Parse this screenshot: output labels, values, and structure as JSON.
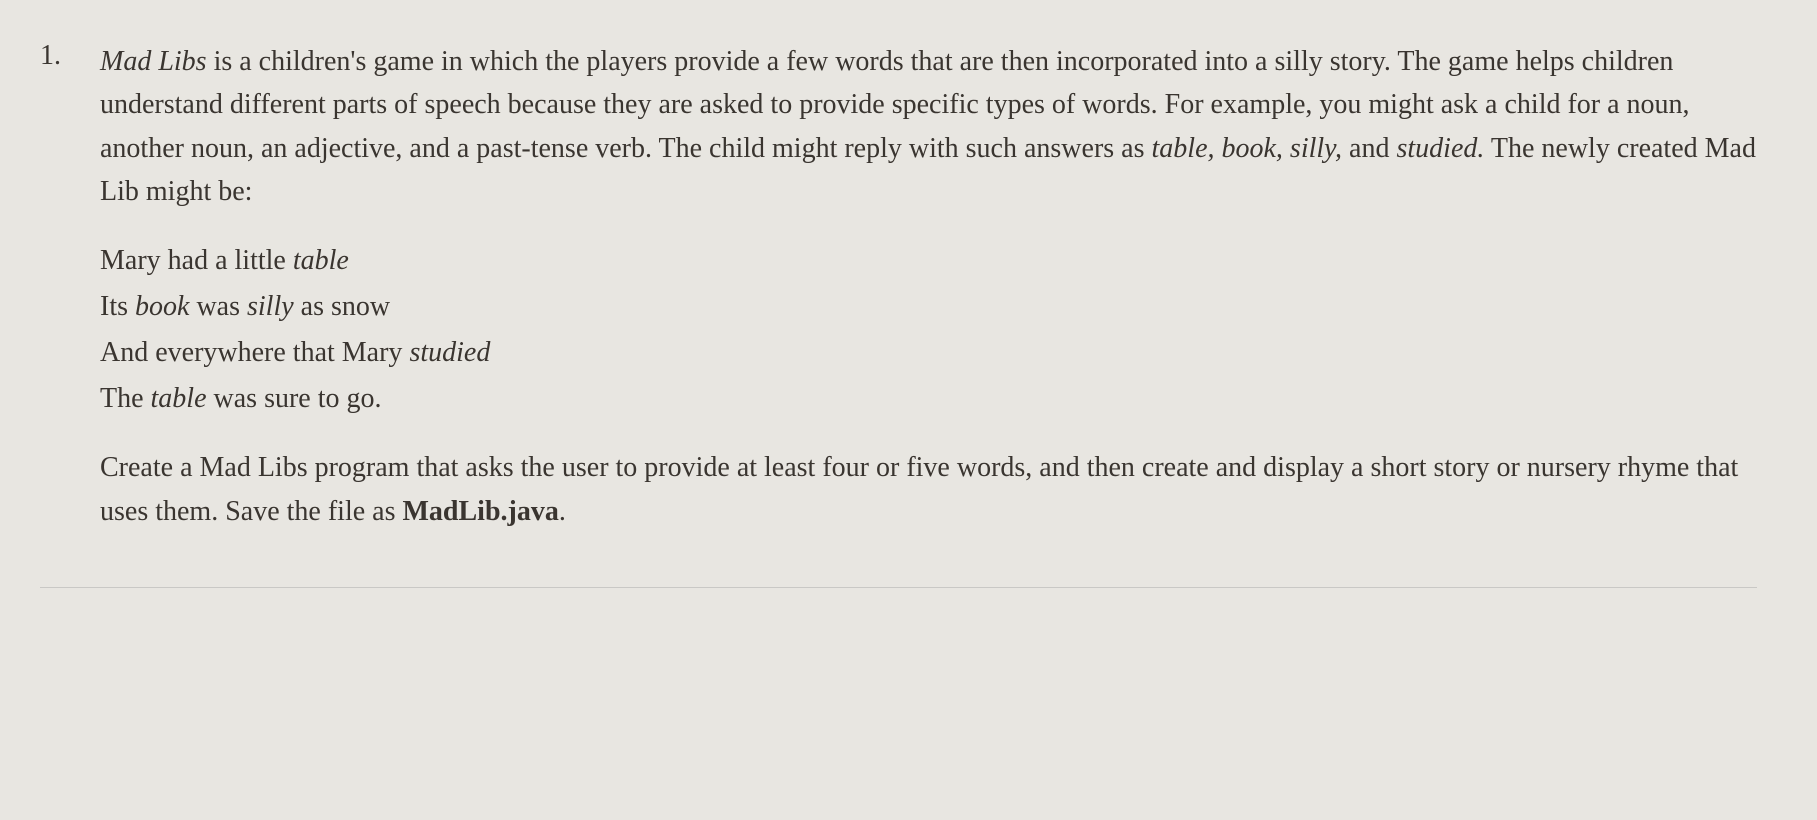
{
  "item": {
    "number": "1.",
    "main_paragraph": {
      "part1": " is a children's game in which the players provide a few words that are then incorporated into a silly story. The game helps children understand different parts of speech because they are asked to provide specific types of words. For example, you might ask a child for a noun, another noun, an adjective, and a past-tense verb. The child might reply with such answers as ",
      "title": "Mad Libs",
      "italic_words": "table, book, silly,",
      "part2": " and ",
      "italic_studied": "studied.",
      "part3": " The newly created Mad Lib might be:"
    },
    "poem": {
      "line1_pre": "Mary had a little ",
      "line1_italic": "table",
      "line2_pre": "Its ",
      "line2_italic1": "book",
      "line2_mid": " was ",
      "line2_italic2": "silly",
      "line2_post": " as snow",
      "line3_pre": "And everywhere that Mary ",
      "line3_italic": "studied",
      "line4_pre": "The ",
      "line4_italic": "table",
      "line4_post": " was sure to go."
    },
    "closing_paragraph": {
      "part1": "Create a Mad Libs program that asks the user to provide at least four or five words, and then create and display a short story or nursery rhyme that uses them. Save the file as ",
      "bold": "MadLib.java",
      "part2": "."
    }
  }
}
